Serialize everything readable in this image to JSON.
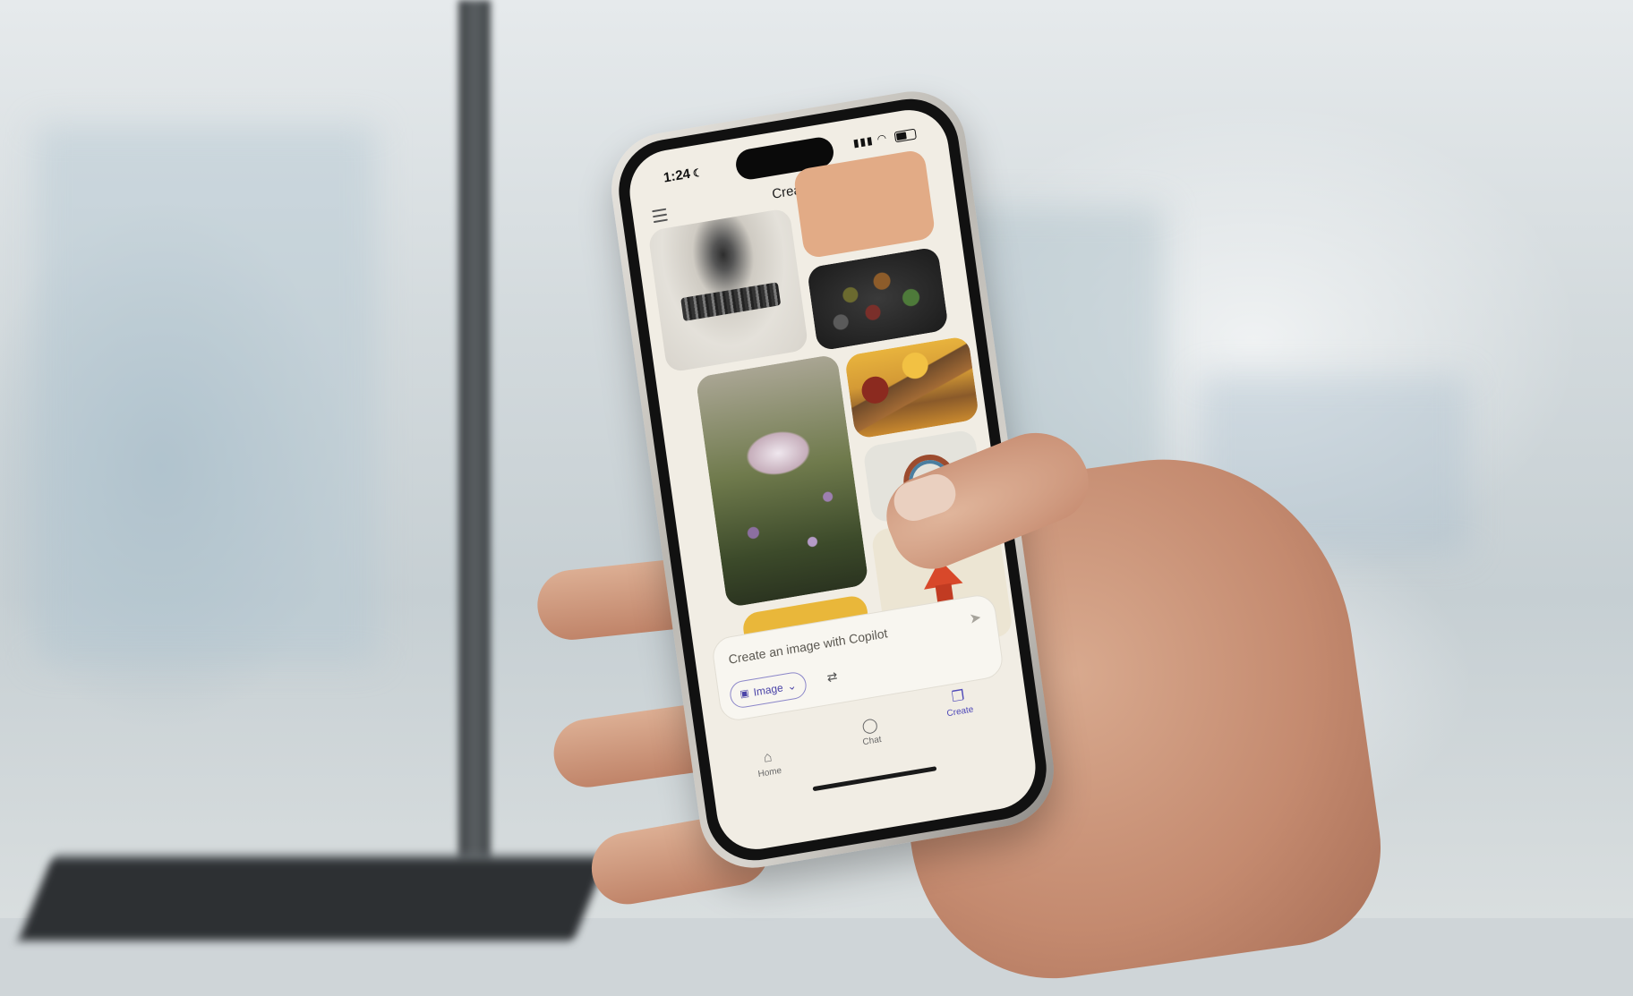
{
  "scene": {
    "description_colors": {
      "accent": "#4f49b8",
      "screen_bg": "#f1ede4"
    }
  },
  "status_bar": {
    "time": "1:24",
    "moon_icon": "moon-icon",
    "signal_icon": "signal-icon",
    "wifi_icon": "wifi-icon",
    "battery_icon": "battery-icon"
  },
  "header": {
    "title": "Create",
    "menu_icon": "hamburger-menu-icon"
  },
  "composer": {
    "placeholder": "Create an image with Copilot",
    "mode_label": "Image",
    "send_icon": "send-icon",
    "settings_icon": "sliders-icon"
  },
  "nav": {
    "items": [
      {
        "label": "Home",
        "icon": "home-icon"
      },
      {
        "label": "Chat",
        "icon": "chat-bubble-icon"
      },
      {
        "label": "Create",
        "icon": "create-icon",
        "active": true
      }
    ]
  }
}
